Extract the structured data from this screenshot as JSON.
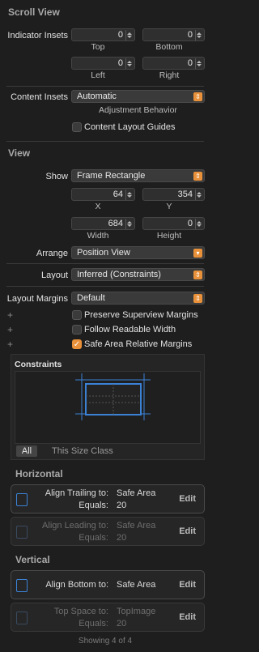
{
  "scroll_view": {
    "title": "Scroll View",
    "indicator_insets_label": "Indicator Insets",
    "top": {
      "value": "0",
      "label": "Top"
    },
    "bottom": {
      "value": "0",
      "label": "Bottom"
    },
    "left": {
      "value": "0",
      "label": "Left"
    },
    "right": {
      "value": "0",
      "label": "Right"
    },
    "content_insets_label": "Content Insets",
    "content_insets_value": "Automatic",
    "adjustment_behavior": "Adjustment Behavior",
    "content_layout_guides": "Content Layout Guides"
  },
  "view": {
    "title": "View",
    "show_label": "Show",
    "show_value": "Frame Rectangle",
    "x": {
      "value": "64",
      "label": "X"
    },
    "y": {
      "value": "354",
      "label": "Y"
    },
    "width": {
      "value": "684",
      "label": "Width"
    },
    "height": {
      "value": "0",
      "label": "Height"
    },
    "arrange_label": "Arrange",
    "arrange_value": "Position View",
    "layout_label": "Layout",
    "layout_value": "Inferred (Constraints)",
    "layout_margins_label": "Layout Margins",
    "layout_margins_value": "Default",
    "preserve_superview_margins": "Preserve Superview Margins",
    "follow_readable_width": "Follow Readable Width",
    "safe_area_relative_margins": "Safe Area Relative Margins"
  },
  "constraints": {
    "title": "Constraints",
    "tab_all": "All",
    "tab_size_class": "This Size Class"
  },
  "horizontal": {
    "title": "Horizontal",
    "items": [
      {
        "line1": "Align Trailing to:",
        "value1": "Safe Area",
        "line2": "Equals:",
        "value2": "20",
        "edit": "Edit"
      },
      {
        "line1": "Align Leading to:",
        "value1": "Safe Area",
        "line2": "Equals:",
        "value2": "20",
        "edit": "Edit"
      }
    ]
  },
  "vertical": {
    "title": "Vertical",
    "items": [
      {
        "line1": "Align Bottom to:",
        "value1": "Safe Area",
        "edit": "Edit"
      },
      {
        "line1": "Top Space to:",
        "value1": "TopImage",
        "line2": "Equals:",
        "value2": "20",
        "edit": "Edit"
      }
    ]
  },
  "footer": "Showing 4 of 4",
  "colors": {
    "accent": "#e8913a",
    "constraint_blue": "#3b82d6"
  }
}
